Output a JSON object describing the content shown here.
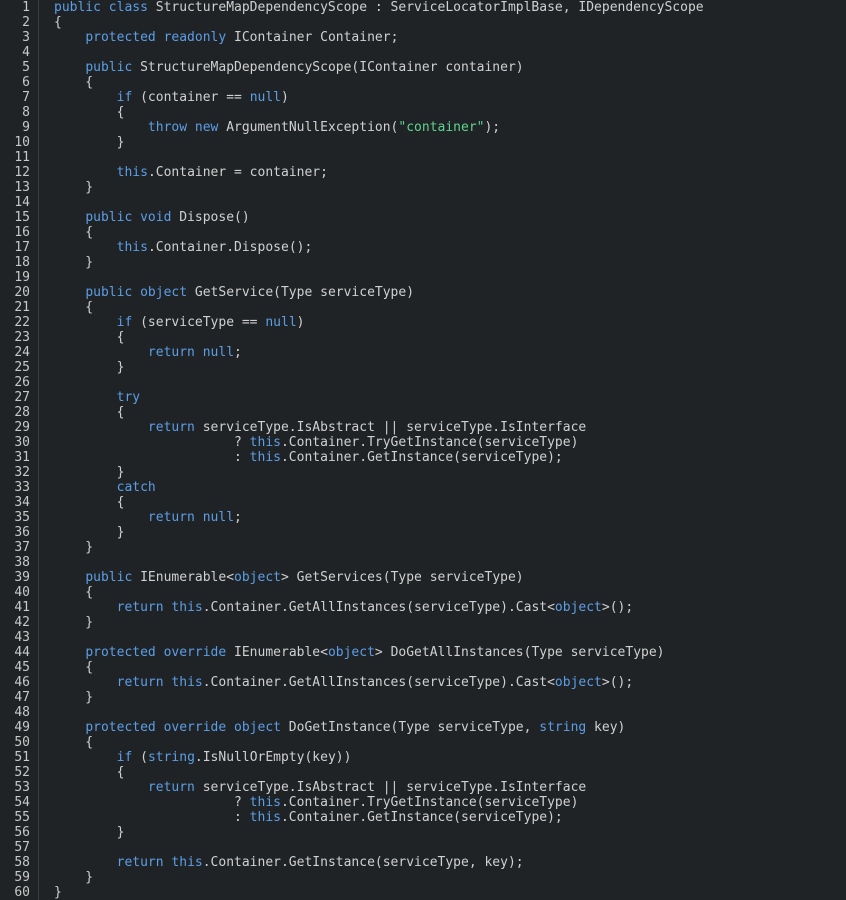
{
  "editor": {
    "lines": [
      {
        "n": "1",
        "tokens": [
          {
            "t": "public class",
            "c": "kw"
          },
          {
            "t": " StructureMapDependencyScope : ServiceLocatorImplBase, IDependencyScope",
            "c": "plain"
          }
        ]
      },
      {
        "n": "2",
        "tokens": [
          {
            "t": "{",
            "c": "plain"
          }
        ]
      },
      {
        "n": "3",
        "tokens": [
          {
            "t": "    ",
            "c": "plain"
          },
          {
            "t": "protected readonly",
            "c": "kw"
          },
          {
            "t": " IContainer Container;",
            "c": "plain"
          }
        ]
      },
      {
        "n": "4",
        "tokens": []
      },
      {
        "n": "5",
        "tokens": [
          {
            "t": "    ",
            "c": "plain"
          },
          {
            "t": "public",
            "c": "kw"
          },
          {
            "t": " StructureMapDependencyScope(IContainer container)",
            "c": "plain"
          }
        ]
      },
      {
        "n": "6",
        "tokens": [
          {
            "t": "    {",
            "c": "plain"
          }
        ]
      },
      {
        "n": "7",
        "tokens": [
          {
            "t": "        ",
            "c": "plain"
          },
          {
            "t": "if",
            "c": "kw"
          },
          {
            "t": " (container == ",
            "c": "plain"
          },
          {
            "t": "null",
            "c": "kw"
          },
          {
            "t": ")",
            "c": "plain"
          }
        ]
      },
      {
        "n": "8",
        "tokens": [
          {
            "t": "        {",
            "c": "plain"
          }
        ]
      },
      {
        "n": "9",
        "tokens": [
          {
            "t": "            ",
            "c": "plain"
          },
          {
            "t": "throw new",
            "c": "kw"
          },
          {
            "t": " ArgumentNullException(",
            "c": "plain"
          },
          {
            "t": "\"container\"",
            "c": "str"
          },
          {
            "t": ");",
            "c": "plain"
          }
        ]
      },
      {
        "n": "10",
        "tokens": [
          {
            "t": "        }",
            "c": "plain"
          }
        ]
      },
      {
        "n": "11",
        "tokens": []
      },
      {
        "n": "12",
        "tokens": [
          {
            "t": "        ",
            "c": "plain"
          },
          {
            "t": "this",
            "c": "kw"
          },
          {
            "t": ".Container = container;",
            "c": "plain"
          }
        ]
      },
      {
        "n": "13",
        "tokens": [
          {
            "t": "    }",
            "c": "plain"
          }
        ]
      },
      {
        "n": "14",
        "tokens": []
      },
      {
        "n": "15",
        "tokens": [
          {
            "t": "    ",
            "c": "plain"
          },
          {
            "t": "public void",
            "c": "kw"
          },
          {
            "t": " Dispose()",
            "c": "plain"
          }
        ]
      },
      {
        "n": "16",
        "tokens": [
          {
            "t": "    {",
            "c": "plain"
          }
        ]
      },
      {
        "n": "17",
        "tokens": [
          {
            "t": "        ",
            "c": "plain"
          },
          {
            "t": "this",
            "c": "kw"
          },
          {
            "t": ".Container.Dispose();",
            "c": "plain"
          }
        ]
      },
      {
        "n": "18",
        "tokens": [
          {
            "t": "    }",
            "c": "plain"
          }
        ]
      },
      {
        "n": "19",
        "tokens": []
      },
      {
        "n": "20",
        "tokens": [
          {
            "t": "    ",
            "c": "plain"
          },
          {
            "t": "public object",
            "c": "kw"
          },
          {
            "t": " GetService(Type serviceType)",
            "c": "plain"
          }
        ]
      },
      {
        "n": "21",
        "tokens": [
          {
            "t": "    {",
            "c": "plain"
          }
        ]
      },
      {
        "n": "22",
        "tokens": [
          {
            "t": "        ",
            "c": "plain"
          },
          {
            "t": "if",
            "c": "kw"
          },
          {
            "t": " (serviceType == ",
            "c": "plain"
          },
          {
            "t": "null",
            "c": "kw"
          },
          {
            "t": ")",
            "c": "plain"
          }
        ]
      },
      {
        "n": "23",
        "tokens": [
          {
            "t": "        {",
            "c": "plain"
          }
        ]
      },
      {
        "n": "24",
        "tokens": [
          {
            "t": "            ",
            "c": "plain"
          },
          {
            "t": "return null",
            "c": "kw"
          },
          {
            "t": ";",
            "c": "plain"
          }
        ]
      },
      {
        "n": "25",
        "tokens": [
          {
            "t": "        }",
            "c": "plain"
          }
        ]
      },
      {
        "n": "26",
        "tokens": []
      },
      {
        "n": "27",
        "tokens": [
          {
            "t": "        ",
            "c": "plain"
          },
          {
            "t": "try",
            "c": "kw"
          }
        ]
      },
      {
        "n": "28",
        "tokens": [
          {
            "t": "        {",
            "c": "plain"
          }
        ]
      },
      {
        "n": "29",
        "tokens": [
          {
            "t": "            ",
            "c": "plain"
          },
          {
            "t": "return",
            "c": "kw"
          },
          {
            "t": " serviceType.IsAbstract || serviceType.IsInterface",
            "c": "plain"
          }
        ]
      },
      {
        "n": "30",
        "tokens": [
          {
            "t": "                       ? ",
            "c": "plain"
          },
          {
            "t": "this",
            "c": "kw"
          },
          {
            "t": ".Container.TryGetInstance(serviceType)",
            "c": "plain"
          }
        ]
      },
      {
        "n": "31",
        "tokens": [
          {
            "t": "                       : ",
            "c": "plain"
          },
          {
            "t": "this",
            "c": "kw"
          },
          {
            "t": ".Container.GetInstance(serviceType);",
            "c": "plain"
          }
        ]
      },
      {
        "n": "32",
        "tokens": [
          {
            "t": "        }",
            "c": "plain"
          }
        ]
      },
      {
        "n": "33",
        "tokens": [
          {
            "t": "        ",
            "c": "plain"
          },
          {
            "t": "catch",
            "c": "kw"
          }
        ]
      },
      {
        "n": "34",
        "tokens": [
          {
            "t": "        {",
            "c": "plain"
          }
        ]
      },
      {
        "n": "35",
        "tokens": [
          {
            "t": "            ",
            "c": "plain"
          },
          {
            "t": "return null",
            "c": "kw"
          },
          {
            "t": ";",
            "c": "plain"
          }
        ]
      },
      {
        "n": "36",
        "tokens": [
          {
            "t": "        }",
            "c": "plain"
          }
        ]
      },
      {
        "n": "37",
        "tokens": [
          {
            "t": "    }",
            "c": "plain"
          }
        ]
      },
      {
        "n": "38",
        "tokens": []
      },
      {
        "n": "39",
        "tokens": [
          {
            "t": "    ",
            "c": "plain"
          },
          {
            "t": "public",
            "c": "kw"
          },
          {
            "t": " IEnumerable<",
            "c": "plain"
          },
          {
            "t": "object",
            "c": "kw"
          },
          {
            "t": "> GetServices(Type serviceType)",
            "c": "plain"
          }
        ]
      },
      {
        "n": "40",
        "tokens": [
          {
            "t": "    {",
            "c": "plain"
          }
        ]
      },
      {
        "n": "41",
        "tokens": [
          {
            "t": "        ",
            "c": "plain"
          },
          {
            "t": "return this",
            "c": "kw"
          },
          {
            "t": ".Container.GetAllInstances(serviceType).Cast<",
            "c": "plain"
          },
          {
            "t": "object",
            "c": "kw"
          },
          {
            "t": ">();",
            "c": "plain"
          }
        ]
      },
      {
        "n": "42",
        "tokens": [
          {
            "t": "    }",
            "c": "plain"
          }
        ]
      },
      {
        "n": "43",
        "tokens": []
      },
      {
        "n": "44",
        "tokens": [
          {
            "t": "    ",
            "c": "plain"
          },
          {
            "t": "protected override",
            "c": "kw"
          },
          {
            "t": " IEnumerable<",
            "c": "plain"
          },
          {
            "t": "object",
            "c": "kw"
          },
          {
            "t": "> DoGetAllInstances(Type serviceType)",
            "c": "plain"
          }
        ]
      },
      {
        "n": "45",
        "tokens": [
          {
            "t": "    {",
            "c": "plain"
          }
        ]
      },
      {
        "n": "46",
        "tokens": [
          {
            "t": "        ",
            "c": "plain"
          },
          {
            "t": "return this",
            "c": "kw"
          },
          {
            "t": ".Container.GetAllInstances(serviceType).Cast<",
            "c": "plain"
          },
          {
            "t": "object",
            "c": "kw"
          },
          {
            "t": ">();",
            "c": "plain"
          }
        ]
      },
      {
        "n": "47",
        "tokens": [
          {
            "t": "    }",
            "c": "plain"
          }
        ]
      },
      {
        "n": "48",
        "tokens": []
      },
      {
        "n": "49",
        "tokens": [
          {
            "t": "    ",
            "c": "plain"
          },
          {
            "t": "protected override object",
            "c": "kw"
          },
          {
            "t": " DoGetInstance(Type serviceType, ",
            "c": "plain"
          },
          {
            "t": "string",
            "c": "kw"
          },
          {
            "t": " key)",
            "c": "plain"
          }
        ]
      },
      {
        "n": "50",
        "tokens": [
          {
            "t": "    {",
            "c": "plain"
          }
        ]
      },
      {
        "n": "51",
        "tokens": [
          {
            "t": "        ",
            "c": "plain"
          },
          {
            "t": "if",
            "c": "kw"
          },
          {
            "t": " (",
            "c": "plain"
          },
          {
            "t": "string",
            "c": "kw"
          },
          {
            "t": ".IsNullOrEmpty(key))",
            "c": "plain"
          }
        ]
      },
      {
        "n": "52",
        "tokens": [
          {
            "t": "        {",
            "c": "plain"
          }
        ]
      },
      {
        "n": "53",
        "tokens": [
          {
            "t": "            ",
            "c": "plain"
          },
          {
            "t": "return",
            "c": "kw"
          },
          {
            "t": " serviceType.IsAbstract || serviceType.IsInterface",
            "c": "plain"
          }
        ]
      },
      {
        "n": "54",
        "tokens": [
          {
            "t": "                       ? ",
            "c": "plain"
          },
          {
            "t": "this",
            "c": "kw"
          },
          {
            "t": ".Container.TryGetInstance(serviceType)",
            "c": "plain"
          }
        ]
      },
      {
        "n": "55",
        "tokens": [
          {
            "t": "                       : ",
            "c": "plain"
          },
          {
            "t": "this",
            "c": "kw"
          },
          {
            "t": ".Container.GetInstance(serviceType);",
            "c": "plain"
          }
        ]
      },
      {
        "n": "56",
        "tokens": [
          {
            "t": "        }",
            "c": "plain"
          }
        ]
      },
      {
        "n": "57",
        "tokens": []
      },
      {
        "n": "58",
        "tokens": [
          {
            "t": "        ",
            "c": "plain"
          },
          {
            "t": "return this",
            "c": "kw"
          },
          {
            "t": ".Container.GetInstance(serviceType, key);",
            "c": "plain"
          }
        ]
      },
      {
        "n": "59",
        "tokens": [
          {
            "t": "    }",
            "c": "plain"
          }
        ]
      },
      {
        "n": "60",
        "tokens": [
          {
            "t": "}",
            "c": "plain"
          }
        ]
      }
    ]
  },
  "colors": {
    "background": "#1f2326",
    "keyword": "#5c9ee6",
    "string": "#5fd38d",
    "text": "#d0d0d0",
    "line_number": "#c8c8c8"
  }
}
